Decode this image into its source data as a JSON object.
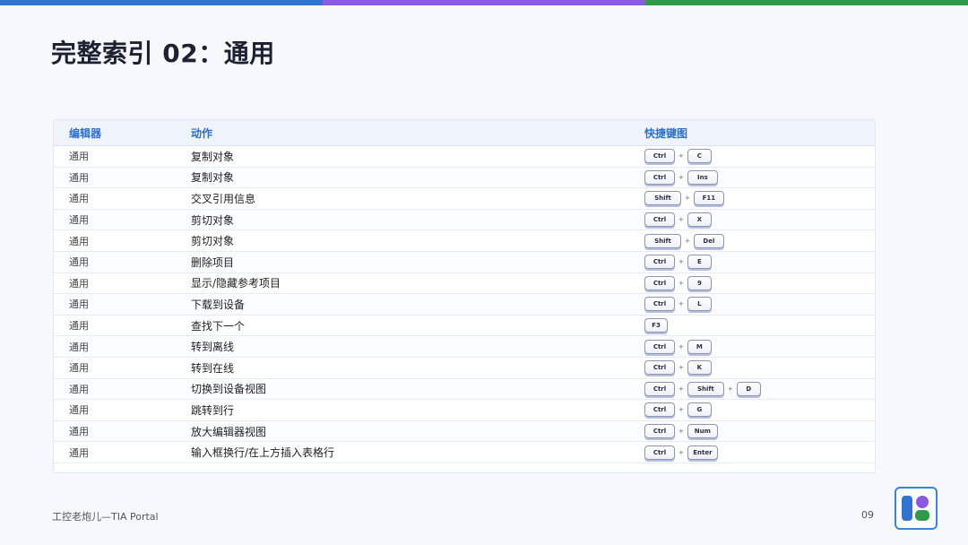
{
  "colors": {
    "bar_blue": "#2f74d0",
    "bar_purple": "#8a5be0",
    "bar_green": "#2f9a4a",
    "header_text": "#2c6fcc"
  },
  "title": "完整索引 02：通用",
  "table": {
    "headers": [
      "编辑器",
      "动作",
      "快捷键图"
    ],
    "rows": [
      {
        "editor": "通用",
        "action": "复制对象",
        "keys": [
          "Ctrl",
          "C"
        ]
      },
      {
        "editor": "通用",
        "action": "复制对象",
        "keys": [
          "Ctrl",
          "Ins"
        ]
      },
      {
        "editor": "通用",
        "action": "交叉引用信息",
        "keys": [
          "Shift",
          "F11"
        ]
      },
      {
        "editor": "通用",
        "action": "剪切对象",
        "keys": [
          "Ctrl",
          "X"
        ]
      },
      {
        "editor": "通用",
        "action": "剪切对象",
        "keys": [
          "Shift",
          "Del"
        ]
      },
      {
        "editor": "通用",
        "action": "删除项目",
        "keys": [
          "Ctrl",
          "E"
        ]
      },
      {
        "editor": "通用",
        "action": "显示/隐藏参考项目",
        "keys": [
          "Ctrl",
          "9"
        ]
      },
      {
        "editor": "通用",
        "action": "下载到设备",
        "keys": [
          "Ctrl",
          "L"
        ]
      },
      {
        "editor": "通用",
        "action": "查找下一个",
        "keys": [
          "F3"
        ]
      },
      {
        "editor": "通用",
        "action": "转到离线",
        "keys": [
          "Ctrl",
          "M"
        ]
      },
      {
        "editor": "通用",
        "action": "转到在线",
        "keys": [
          "Ctrl",
          "K"
        ]
      },
      {
        "editor": "通用",
        "action": "切换到设备视图",
        "keys": [
          "Ctrl",
          "Shift",
          "D"
        ]
      },
      {
        "editor": "通用",
        "action": "跳转到行",
        "keys": [
          "Ctrl",
          "G"
        ]
      },
      {
        "editor": "通用",
        "action": "放大编辑器视图",
        "keys": [
          "Ctrl",
          "Num"
        ]
      },
      {
        "editor": "通用",
        "action": "输入框换行/在上方插入表格行",
        "keys": [
          "Ctrl",
          "Enter"
        ]
      }
    ],
    "plus_sign": "+"
  },
  "footer": {
    "left": "工控老炮儿—TIA Portal",
    "page_number": "09"
  },
  "logo": {
    "icon": "app-logo-icon"
  }
}
